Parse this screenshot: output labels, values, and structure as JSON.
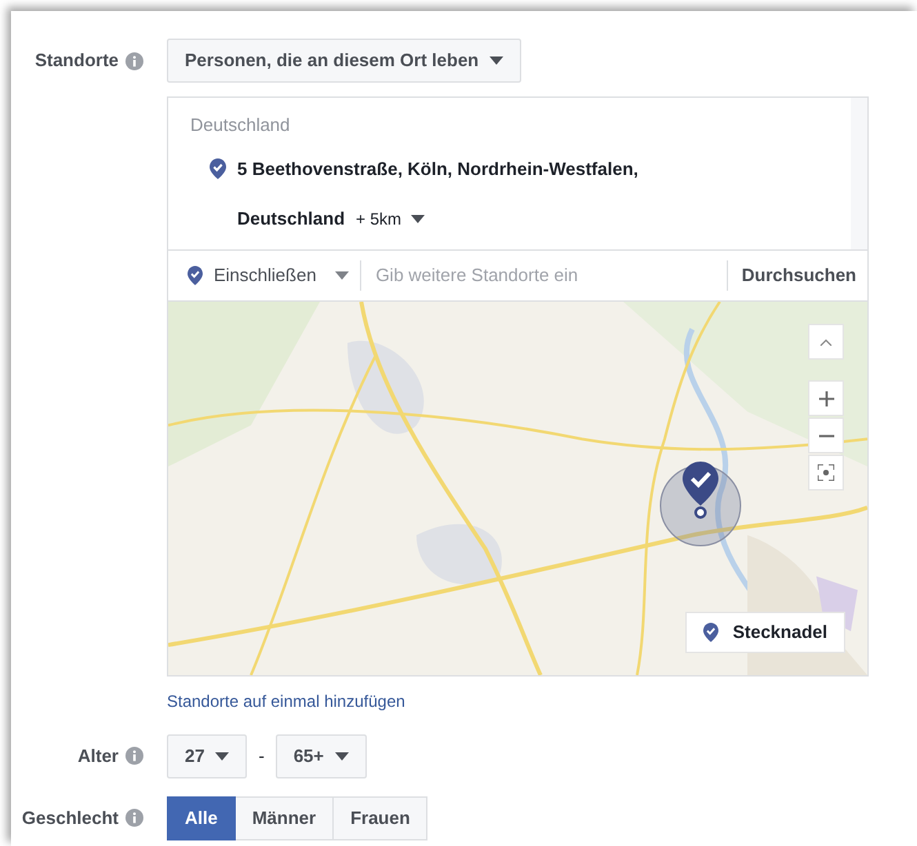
{
  "standorte": {
    "label": "Standorte",
    "dropdown": "Personen, die an diesem Ort leben",
    "country": "Deutschland",
    "location": {
      "address_line1": "5 Beethovenstraße, Köln, Nordrhein-Westfalen,",
      "address_line2": "Deutschland",
      "radius": "+ 5km"
    },
    "include_dropdown": "Einschließen",
    "search": {
      "placeholder": "Gib weitere Standorte ein",
      "button": "Durchsuchen"
    },
    "map": {
      "kind": "picture",
      "pin_button": "Stecknadel"
    },
    "bulk_link": "Standorte auf einmal hinzufügen"
  },
  "alter": {
    "label": "Alter",
    "min": "27",
    "separator": "-",
    "max": "65+"
  },
  "geschlecht": {
    "label": "Geschlecht",
    "options": [
      {
        "label": "Alle",
        "selected": true
      },
      {
        "label": "Männer",
        "selected": false
      },
      {
        "label": "Frauen",
        "selected": false
      }
    ]
  }
}
